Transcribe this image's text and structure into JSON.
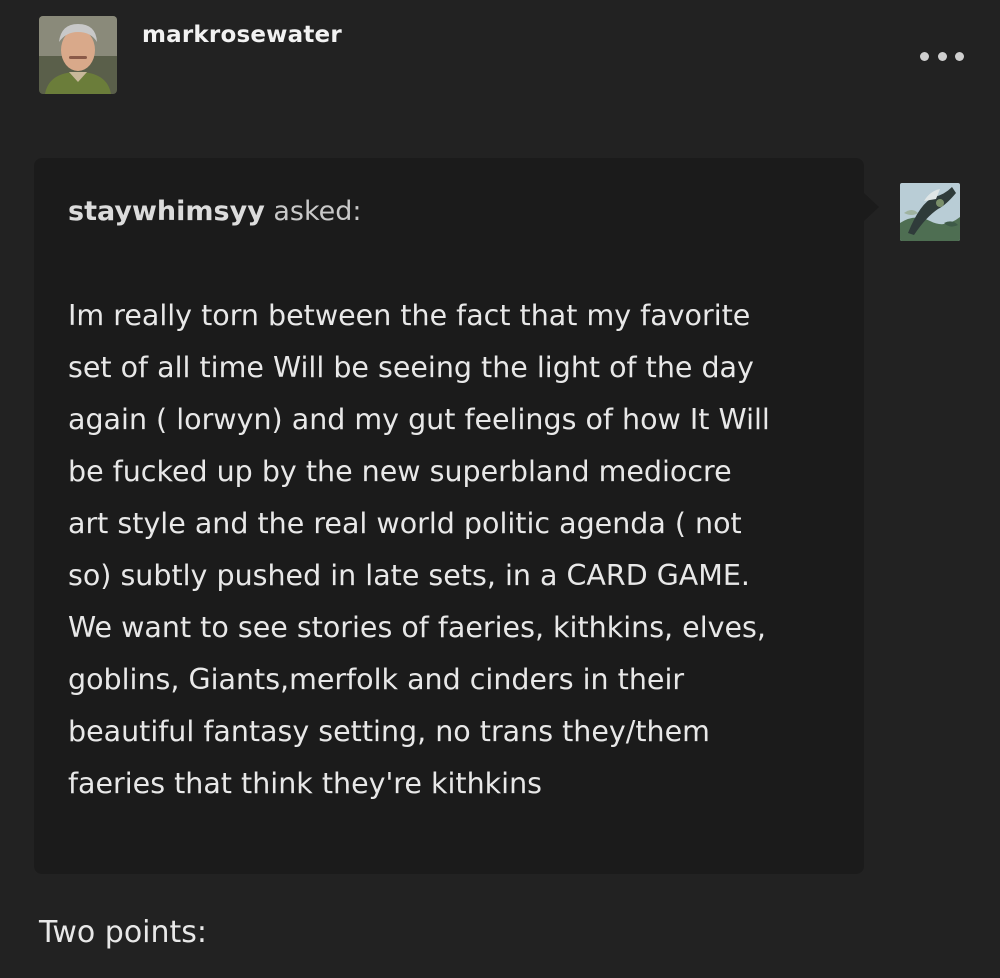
{
  "post": {
    "author": "markrosewater",
    "author_avatar_icon": "user-avatar-photo",
    "more_icon": "ellipsis-icon"
  },
  "ask": {
    "asker": "staywhimsyy",
    "asked_label": "asked:",
    "asker_avatar_icon": "asker-avatar-art",
    "question_lines": [
      "Im really torn between the fact that my favorite",
      "set of all time Will be seeing the light of the day",
      "again ( lorwyn) and my gut feelings of how It Will",
      "be fucked up by the new superbland mediocre",
      "art style and the real world politic agenda ( not",
      "so) subtly pushed in late sets, in a CARD GAME.",
      "We want to see stories of faeries, kithkins, elves,",
      "goblins, Giants,merfolk and cinders in their",
      "beautiful fantasy setting, no trans they/them",
      "faeries that think they're kithkins"
    ]
  },
  "answer": {
    "first_line": "Two points:"
  },
  "colors": {
    "background": "#222222",
    "bubble": "#1b1b1b",
    "text": "#e8e8e8"
  }
}
